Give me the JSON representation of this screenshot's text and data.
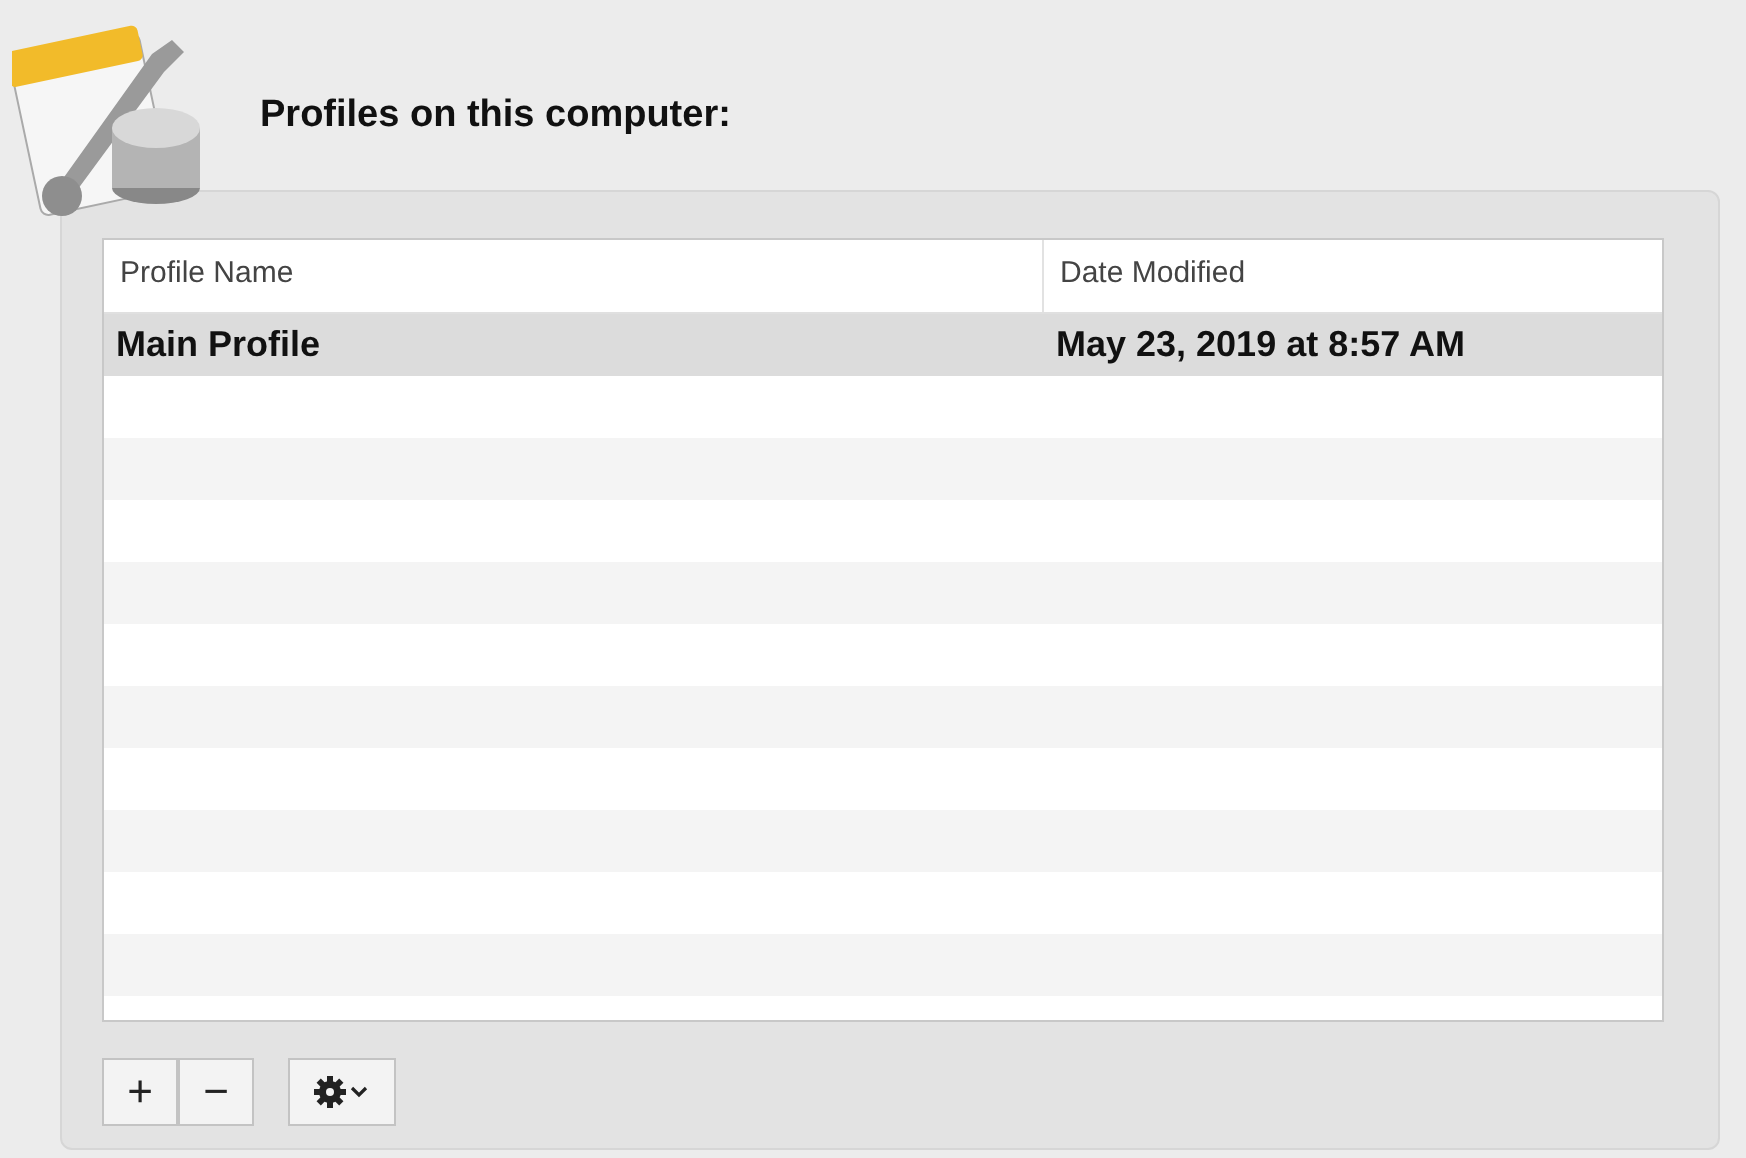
{
  "title": "Profiles on this computer:",
  "table": {
    "columns": [
      "Profile Name",
      "Date Modified"
    ],
    "rows": [
      {
        "cells": [
          "Main Profile",
          "May 23, 2019 at 8:57 AM"
        ],
        "selected": true
      }
    ]
  },
  "buttons": [
    {
      "kind": "text",
      "label": "+"
    },
    {
      "kind": "text",
      "label": "−"
    },
    {
      "kind": "menu"
    }
  ]
}
